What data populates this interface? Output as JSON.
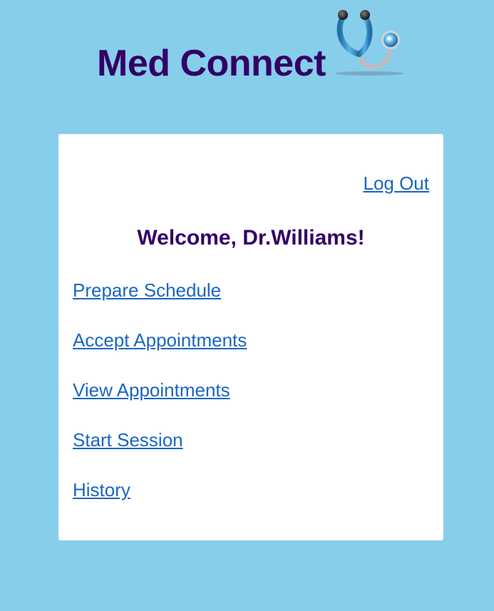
{
  "header": {
    "app_title": "Med Connect",
    "logo_icon": "stethoscope-icon",
    "title_color": "#330066"
  },
  "card": {
    "logout_label": "Log Out",
    "welcome_text": "Welcome, Dr.Williams!",
    "nav_items": [
      {
        "label": "Prepare Schedule"
      },
      {
        "label": "Accept Appointments"
      },
      {
        "label": "View Appointments"
      },
      {
        "label": "Start Session"
      },
      {
        "label": "History"
      }
    ],
    "link_color": "#1a66c2"
  },
  "theme": {
    "background": "#87ceeb",
    "card_background": "#ffffff"
  }
}
